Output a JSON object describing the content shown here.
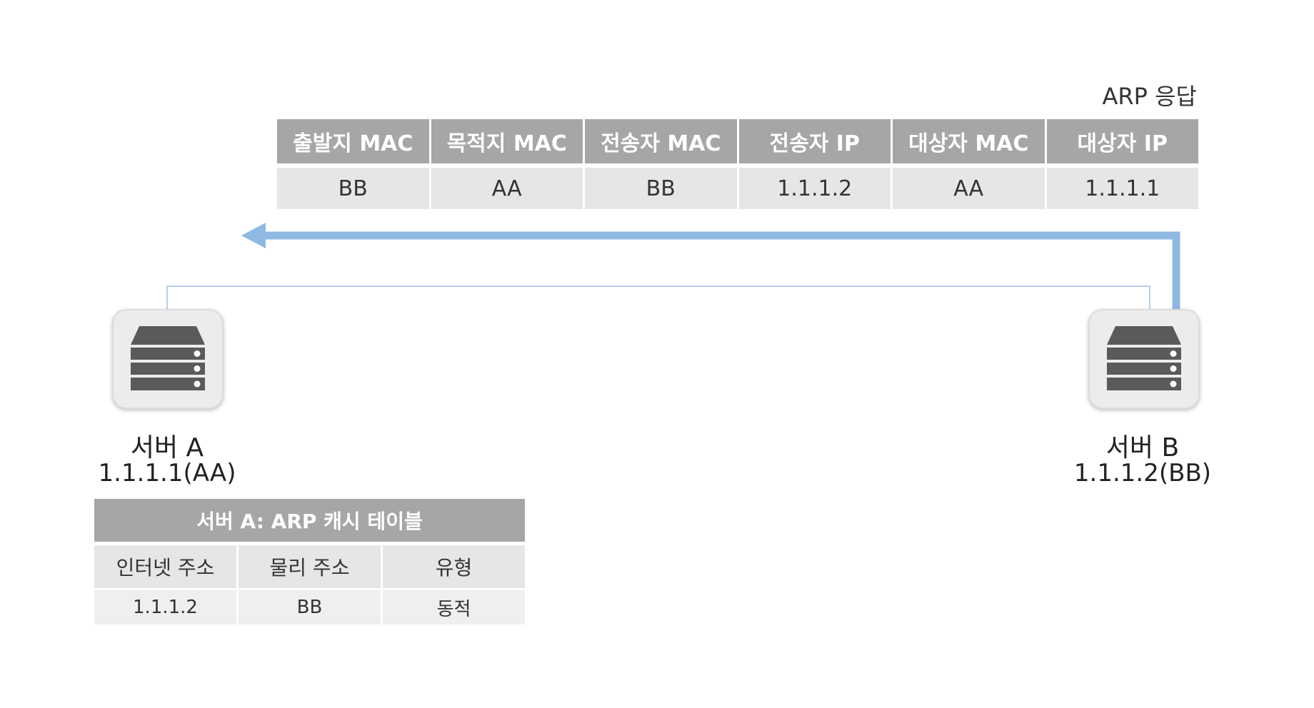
{
  "arp_caption": "ARP 응답",
  "packet": {
    "headers": [
      "출발지 MAC",
      "목적지 MAC",
      "전송자 MAC",
      "전송자 IP",
      "대상자 MAC",
      "대상자 IP"
    ],
    "values": [
      "BB",
      "AA",
      "BB",
      "1.1.1.2",
      "AA",
      "1.1.1.1"
    ]
  },
  "server_a": {
    "name": "서버 A",
    "addr": "1.1.1.1(AA)",
    "icon": "server-icon"
  },
  "server_b": {
    "name": "서버 B",
    "addr": "1.1.1.2(BB)",
    "icon": "server-icon"
  },
  "cache_table": {
    "title": "서버 A: ARP 캐시 테이블",
    "headers": [
      "인터넷 주소",
      "물리 주소",
      "유형"
    ],
    "rows": [
      [
        "1.1.1.2",
        "BB",
        "동적"
      ]
    ]
  },
  "colors": {
    "header_gray": "#a6a6a6",
    "cell_gray": "#e6e6e6",
    "arrow_blue": "#8fb9e2",
    "link_blue": "#9cc3e6",
    "server_dark": "#5a5a5a"
  }
}
